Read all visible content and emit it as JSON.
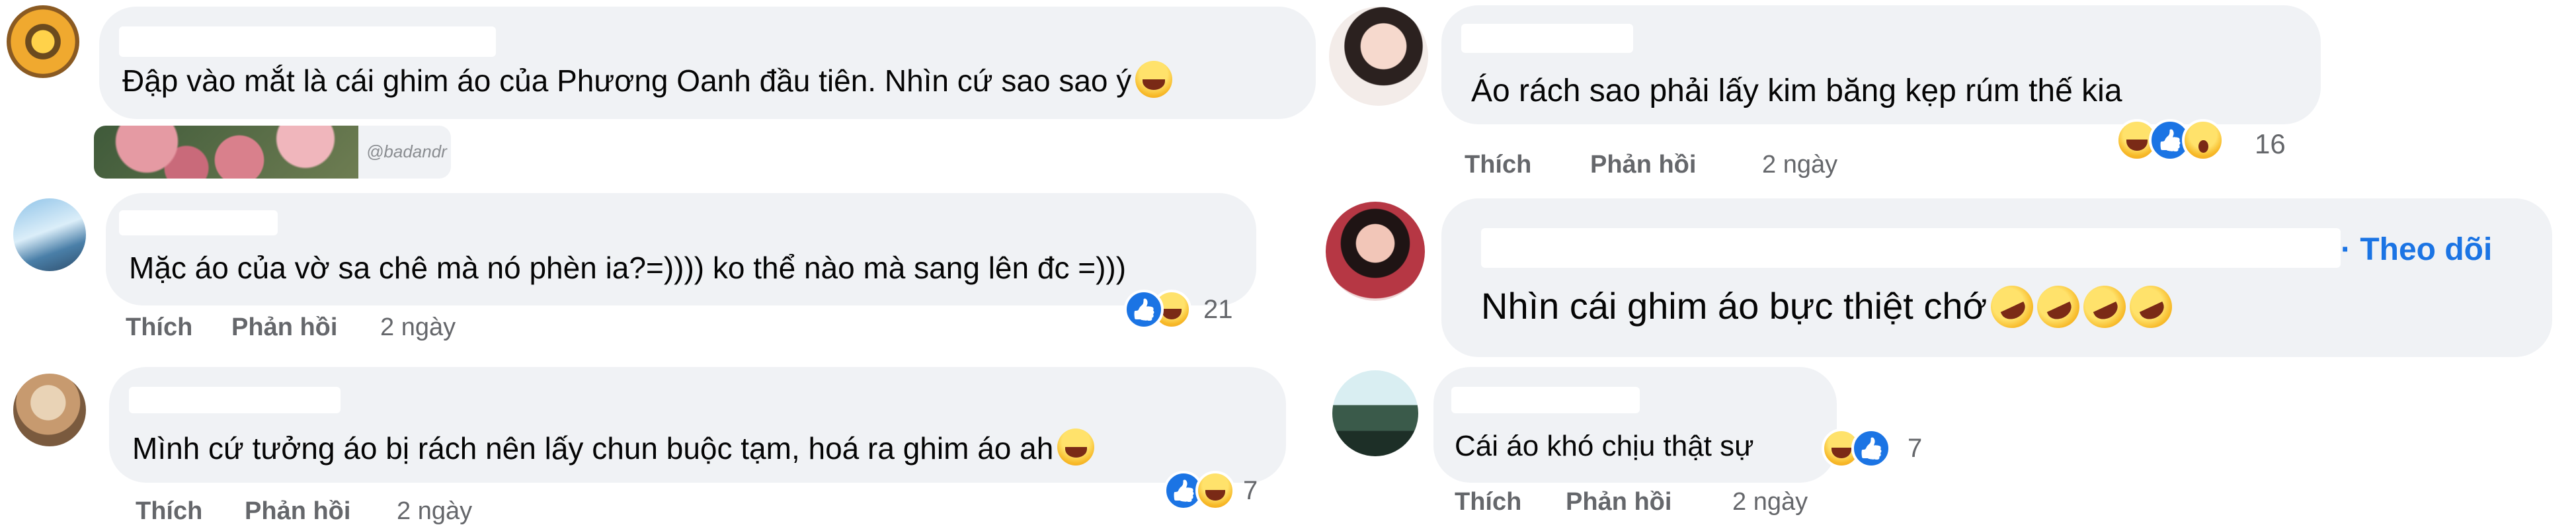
{
  "comments_left": [
    {
      "text": "Đập vào mắt là cái ghim áo của Phương Oanh đầu tiên. Nhìn cứ sao sao ý",
      "emoji": "grinning-squinting-face",
      "attachment_caption": "@badandr"
    },
    {
      "text": "Mặc áo của vờ sa chê mà nó phèn ia?=)))) ko thể nào mà sang lên đc =)))",
      "reactions": [
        "like",
        "haha"
      ],
      "reaction_count": "21",
      "actions": {
        "like": "Thích",
        "reply": "Phản hồi"
      },
      "time": "2 ngày"
    },
    {
      "text": "Mình cứ tưởng áo bị rách nên lấy chun buộc tạm, hoá ra ghim áo ah",
      "emoji": "grinning-face",
      "reactions": [
        "like",
        "haha"
      ],
      "reaction_count": "7",
      "actions": {
        "like": "Thích",
        "reply": "Phản hồi"
      },
      "time": "2 ngày"
    }
  ],
  "comments_right": [
    {
      "text": "Áo rách sao phải lấy kim băng kẹp rúm thế kia",
      "reactions": [
        "haha",
        "like",
        "wow"
      ],
      "reaction_count": "16",
      "actions": {
        "like": "Thích",
        "reply": "Phản hồi"
      },
      "time": "2 ngày"
    },
    {
      "follow_label": "· Theo dõi",
      "text": "Nhìn cái ghim áo bực thiệt chớ",
      "emoji": [
        "rofl",
        "rofl",
        "rofl",
        "rofl"
      ]
    },
    {
      "text": "Cái áo khó chịu thật sự",
      "reactions": [
        "haha",
        "like"
      ],
      "reaction_count": "7",
      "actions": {
        "like": "Thích",
        "reply": "Phản hồi"
      },
      "time": "2 ngày"
    }
  ],
  "colors": {
    "bubble": "#f0f2f5",
    "meta_text": "#65676b",
    "link_blue": "#1b74e4",
    "like_blue": "#1b74e4",
    "haha_yellow": "#f7b928"
  }
}
